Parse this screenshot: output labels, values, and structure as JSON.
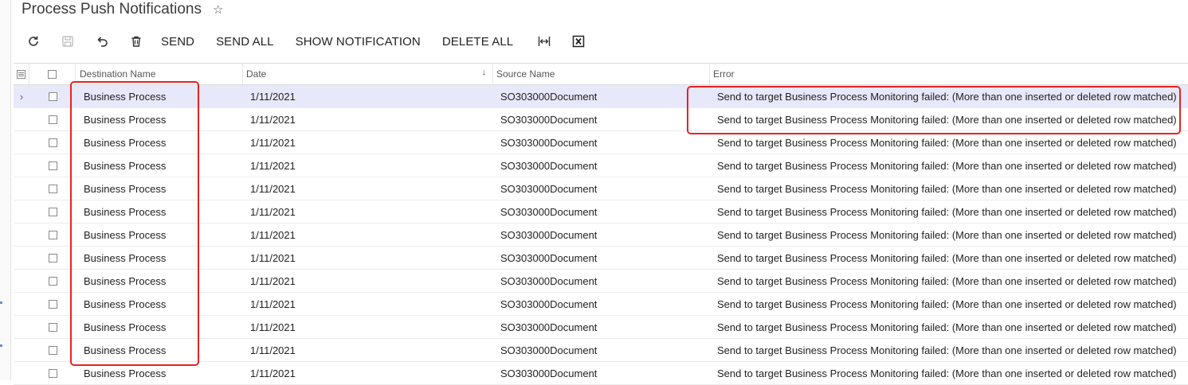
{
  "page": {
    "title": "Process Push Notifications",
    "favorite_icon": "star-outline-icon"
  },
  "toolbar": {
    "refresh_icon": "refresh-icon",
    "save_icon": "save-icon",
    "undo_icon": "undo-icon",
    "delete_icon": "trash-icon",
    "send_label": "SEND",
    "send_all_label": "SEND ALL",
    "show_notification_label": "SHOW NOTIFICATION",
    "delete_all_label": "DELETE ALL",
    "fit_columns_icon": "fit-columns-icon",
    "export_excel_icon": "excel-export-icon"
  },
  "grid": {
    "columns": {
      "destination_name": "Destination Name",
      "date": "Date",
      "source_name": "Source Name",
      "error": "Error"
    },
    "sorted_column": "Date",
    "rows": [
      {
        "destination": "Business Process",
        "date": "1/11/2021",
        "source": "SO303000Document",
        "error": "Send to target Business Process Monitoring failed: (More than one inserted or deleted row matched)"
      },
      {
        "destination": "Business Process",
        "date": "1/11/2021",
        "source": "SO303000Document",
        "error": "Send to target Business Process Monitoring failed: (More than one inserted or deleted row matched)"
      },
      {
        "destination": "Business Process",
        "date": "1/11/2021",
        "source": "SO303000Document",
        "error": "Send to target Business Process Monitoring failed: (More than one inserted or deleted row matched)"
      },
      {
        "destination": "Business Process",
        "date": "1/11/2021",
        "source": "SO303000Document",
        "error": "Send to target Business Process Monitoring failed: (More than one inserted or deleted row matched)"
      },
      {
        "destination": "Business Process",
        "date": "1/11/2021",
        "source": "SO303000Document",
        "error": "Send to target Business Process Monitoring failed: (More than one inserted or deleted row matched)"
      },
      {
        "destination": "Business Process",
        "date": "1/11/2021",
        "source": "SO303000Document",
        "error": "Send to target Business Process Monitoring failed: (More than one inserted or deleted row matched)"
      },
      {
        "destination": "Business Process",
        "date": "1/11/2021",
        "source": "SO303000Document",
        "error": "Send to target Business Process Monitoring failed: (More than one inserted or deleted row matched)"
      },
      {
        "destination": "Business Process",
        "date": "1/11/2021",
        "source": "SO303000Document",
        "error": "Send to target Business Process Monitoring failed: (More than one inserted or deleted row matched)"
      },
      {
        "destination": "Business Process",
        "date": "1/11/2021",
        "source": "SO303000Document",
        "error": "Send to target Business Process Monitoring failed: (More than one inserted or deleted row matched)"
      },
      {
        "destination": "Business Process",
        "date": "1/11/2021",
        "source": "SO303000Document",
        "error": "Send to target Business Process Monitoring failed: (More than one inserted or deleted row matched)"
      },
      {
        "destination": "Business Process",
        "date": "1/11/2021",
        "source": "SO303000Document",
        "error": "Send to target Business Process Monitoring failed: (More than one inserted or deleted row matched)"
      },
      {
        "destination": "Business Process",
        "date": "1/11/2021",
        "source": "SO303000Document",
        "error": "Send to target Business Process Monitoring failed: (More than one inserted or deleted row matched)"
      },
      {
        "destination": "Business Process",
        "date": "1/11/2021",
        "source": "SO303000Document",
        "error": "Send to target Business Process Monitoring failed: (More than one inserted or deleted row matched)"
      }
    ],
    "selected_row_index": 0
  },
  "colors": {
    "selected_row_bg": "#e8e8fb",
    "highlight_border": "#e52222"
  }
}
